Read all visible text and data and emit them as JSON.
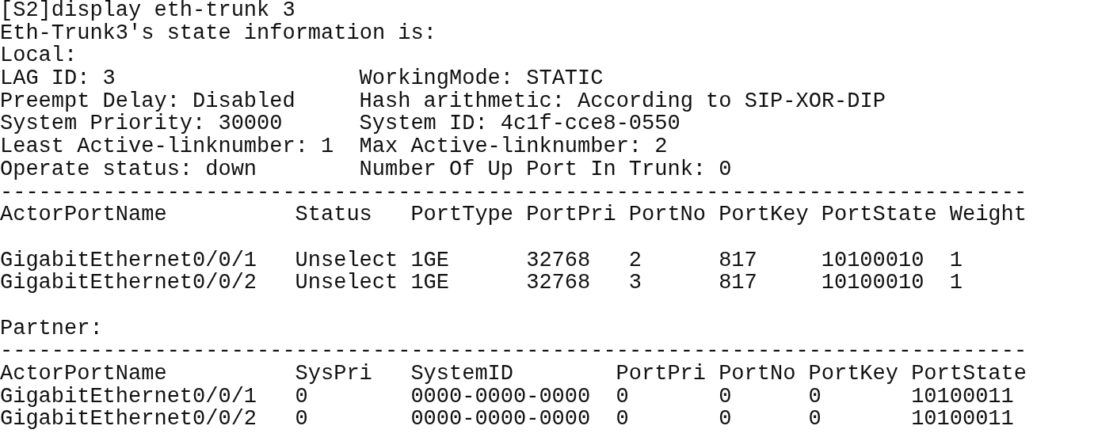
{
  "command": "[S2]display eth-trunk 3",
  "title": "Eth-Trunk3's state information is:",
  "local": {
    "label": "Local:",
    "fields": [
      [
        "LAG ID: 3",
        "WorkingMode: STATIC"
      ],
      [
        "Preempt Delay: Disabled",
        "Hash arithmetic: According to SIP-XOR-DIP"
      ],
      [
        "System Priority: 30000",
        "System ID: 4c1f-cce8-0550"
      ],
      [
        "Least Active-linknumber: 1",
        "Max Active-linknumber: 2"
      ],
      [
        "Operate status: down",
        "Number Of Up Port In Trunk: 0"
      ]
    ],
    "separator": "--------------------------------------------------------------------------------",
    "table": {
      "columns": [
        "ActorPortName",
        "Status",
        "PortType",
        "PortPri",
        "PortNo",
        "PortKey",
        "PortState",
        "Weight"
      ],
      "rows": [
        [
          "GigabitEthernet0/0/1",
          "Unselect",
          "1GE",
          "32768",
          "2",
          "817",
          "10100010",
          "1"
        ],
        [
          "GigabitEthernet0/0/2",
          "Unselect",
          "1GE",
          "32768",
          "3",
          "817",
          "10100010",
          "1"
        ]
      ]
    }
  },
  "partner": {
    "label": "Partner:",
    "separator": "--------------------------------------------------------------------------------",
    "table": {
      "columns": [
        "ActorPortName",
        "SysPri",
        "SystemID",
        "PortPri",
        "PortNo",
        "PortKey",
        "PortState"
      ],
      "rows": [
        [
          "GigabitEthernet0/0/1",
          "0",
          "0000-0000-0000",
          "0",
          "0",
          "0",
          "10100011"
        ],
        [
          "GigabitEthernet0/0/2",
          "0",
          "0000-0000-0000",
          "0",
          "0",
          "0",
          "10100011"
        ]
      ]
    }
  }
}
